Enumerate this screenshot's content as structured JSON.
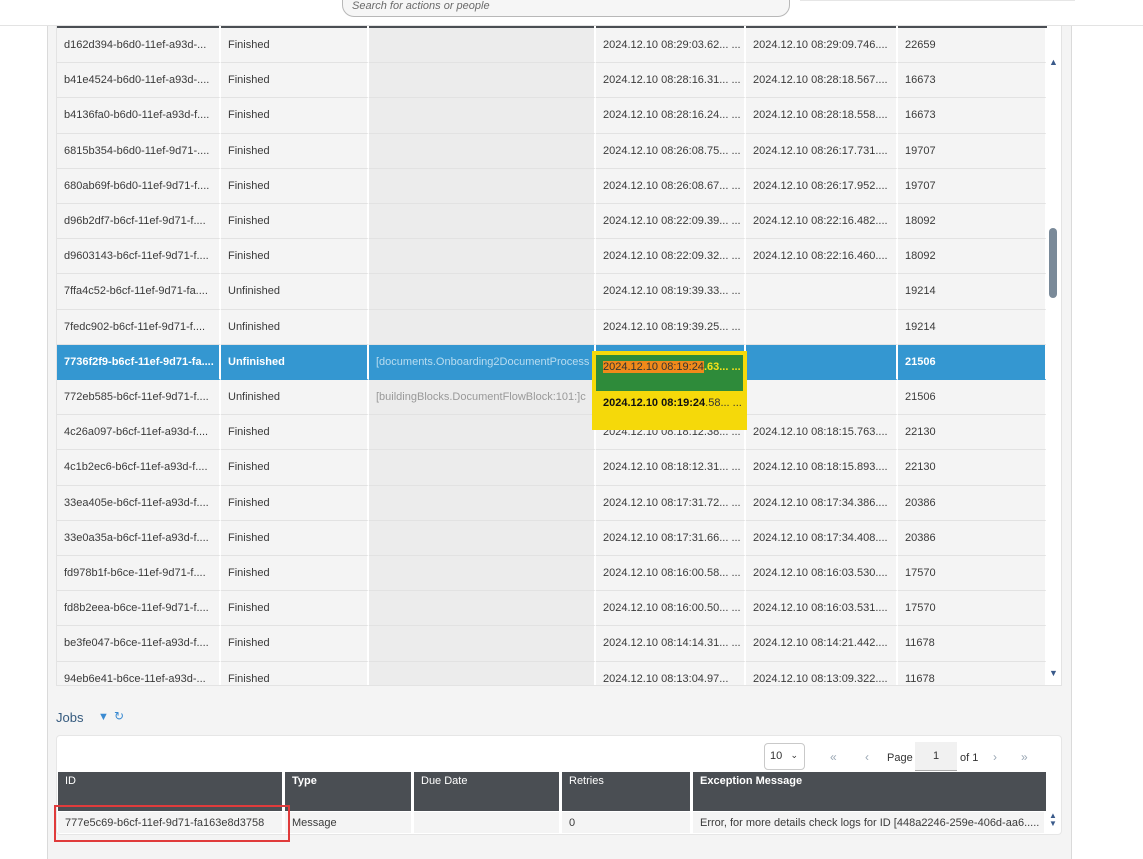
{
  "search": {
    "placeholder": "Search for actions or people"
  },
  "instances_table": {
    "rows": [
      {
        "id": "d162d394-b6d0-11ef-a93d-...",
        "status": "Finished",
        "activity": "",
        "start": "2024.12.10 08:29:03.62... ...",
        "end": "2024.12.10 08:29:09.746....",
        "duration": "22659"
      },
      {
        "id": "b41e4524-b6d0-11ef-a93d-....",
        "status": "Finished",
        "activity": "",
        "start": "2024.12.10 08:28:16.31... ...",
        "end": "2024.12.10 08:28:18.567....",
        "duration": "16673"
      },
      {
        "id": "b4136fa0-b6d0-11ef-a93d-f....",
        "status": "Finished",
        "activity": "",
        "start": "2024.12.10 08:28:16.24... ...",
        "end": "2024.12.10 08:28:18.558....",
        "duration": "16673"
      },
      {
        "id": "6815b354-b6d0-11ef-9d71-....",
        "status": "Finished",
        "activity": "",
        "start": "2024.12.10 08:26:08.75... ...",
        "end": "2024.12.10 08:26:17.731....",
        "duration": "19707"
      },
      {
        "id": "680ab69f-b6d0-11ef-9d71-f....",
        "status": "Finished",
        "activity": "",
        "start": "2024.12.10 08:26:08.67... ...",
        "end": "2024.12.10 08:26:17.952....",
        "duration": "19707"
      },
      {
        "id": "d96b2df7-b6cf-11ef-9d71-f....",
        "status": "Finished",
        "activity": "",
        "start": "2024.12.10 08:22:09.39... ...",
        "end": "2024.12.10 08:22:16.482....",
        "duration": "18092"
      },
      {
        "id": "d9603143-b6cf-11ef-9d71-f....",
        "status": "Finished",
        "activity": "",
        "start": "2024.12.10 08:22:09.32... ...",
        "end": "2024.12.10 08:22:16.460....",
        "duration": "18092"
      },
      {
        "id": "7ffa4c52-b6cf-11ef-9d71-fa....",
        "status": "Unfinished",
        "activity": "",
        "start": "2024.12.10 08:19:39.33... ...",
        "end": "",
        "duration": "19214"
      },
      {
        "id": "7fedc902-b6cf-11ef-9d71-f....",
        "status": "Unfinished",
        "activity": "",
        "start": "2024.12.10 08:19:39.25... ...",
        "end": "",
        "duration": "19214"
      },
      {
        "id": "7736f2f9-b6cf-11ef-9d71-fa....",
        "status": "Unfinished",
        "activity": "[documents.Onboarding2DocumentProcess",
        "start": "",
        "end": "",
        "duration": "21506",
        "selected": true
      },
      {
        "id": "772eb585-b6cf-11ef-9d71-f....",
        "status": "Unfinished",
        "activity": "[buildingBlocks.DocumentFlowBlock:101:]c",
        "start": "",
        "end": "",
        "duration": "21506"
      },
      {
        "id": "4c26a097-b6cf-11ef-a93d-f....",
        "status": "Finished",
        "activity": "",
        "start": "2024.12.10 08:18:12.38... ...",
        "end": "2024.12.10 08:18:15.763....",
        "duration": "22130"
      },
      {
        "id": "4c1b2ec6-b6cf-11ef-a93d-f....",
        "status": "Finished",
        "activity": "",
        "start": "2024.12.10 08:18:12.31... ...",
        "end": "2024.12.10 08:18:15.893....",
        "duration": "22130"
      },
      {
        "id": "33ea405e-b6cf-11ef-a93d-f....",
        "status": "Finished",
        "activity": "",
        "start": "2024.12.10 08:17:31.72... ...",
        "end": "2024.12.10 08:17:34.386....",
        "duration": "20386"
      },
      {
        "id": "33e0a35a-b6cf-11ef-a93d-f....",
        "status": "Finished",
        "activity": "",
        "start": "2024.12.10 08:17:31.66... ...",
        "end": "2024.12.10 08:17:34.408....",
        "duration": "20386"
      },
      {
        "id": "fd978b1f-b6ce-11ef-9d71-f....",
        "status": "Finished",
        "activity": "",
        "start": "2024.12.10 08:16:00.58... ...",
        "end": "2024.12.10 08:16:03.530....",
        "duration": "17570"
      },
      {
        "id": "fd8b2eea-b6ce-11ef-9d71-f....",
        "status": "Finished",
        "activity": "",
        "start": "2024.12.10 08:16:00.50... ...",
        "end": "2024.12.10 08:16:03.531....",
        "duration": "17570"
      },
      {
        "id": "be3fe047-b6ce-11ef-a93d-f....",
        "status": "Finished",
        "activity": "",
        "start": "2024.12.10 08:14:14.31... ...",
        "end": "2024.12.10 08:14:21.442....",
        "duration": "11678"
      },
      {
        "id": "94eb6e41-b6ce-11ef-a93d-...",
        "status": "Finished",
        "activity": "",
        "start": "2024.12.10 08:13:04.97...",
        "end": "2024.12.10 08:13:09.322....",
        "duration": "11678"
      }
    ],
    "highlight_selected_start": {
      "orange": "2024.12.10 08:19:24",
      "rest": ".63... ..."
    },
    "highlight_next_start": {
      "bold": "2024.12.10 08:19:24",
      "rest": ".58... ..."
    }
  },
  "jobs": {
    "title": "Jobs",
    "page_size": "10",
    "page_label": "Page",
    "page_value": "1",
    "of_label": "of 1",
    "columns": [
      "ID",
      "Type",
      "Due Date",
      "Retries",
      "Exception Message"
    ],
    "rows": [
      {
        "id": "777e5c69-b6cf-11ef-9d71-fa163e8d3758",
        "type": "Message",
        "due_date": "",
        "retries": "0",
        "exception": "Error, for more details check logs for ID [448a2246-259e-406d-aa6....."
      }
    ]
  },
  "colors": {
    "header": "#4a4e53",
    "selected_row": "#3497d1",
    "highlight_yellow": "#f5d90a",
    "highlight_green": "#2e8b3a",
    "annotation_red": "#e03b3b"
  }
}
